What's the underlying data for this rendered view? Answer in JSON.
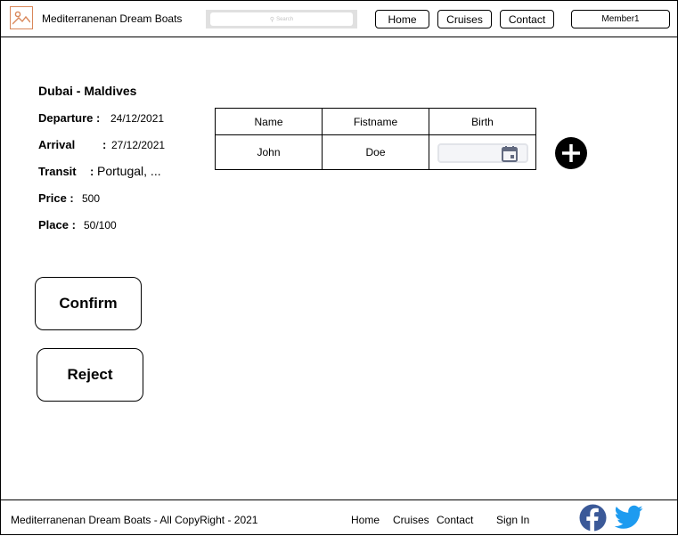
{
  "header": {
    "brand": "Mediterranenan Dream Boats",
    "search_placeholder": "Search",
    "nav": {
      "home": "Home",
      "cruises": "Cruises",
      "contact": "Contact"
    },
    "member": "Member1"
  },
  "trip": {
    "route": "Dubai - Maldives",
    "departure_label": "Departure :",
    "departure_value": "24/12/2021",
    "arrival_label": "Arrival",
    "arrival_colon": ":",
    "arrival_value": "27/12/2021",
    "transit_label": "Transit",
    "transit_colon": ":",
    "transit_value": "Portugal, ...",
    "price_label": "Price :",
    "price_value": "500",
    "place_label": "Place :",
    "place_value": "50/100"
  },
  "passengers": {
    "columns": [
      "Name",
      "Fistname",
      "Birth"
    ],
    "rows": [
      {
        "name": "John",
        "firstname": "Doe",
        "birth": ""
      }
    ]
  },
  "actions": {
    "confirm": "Confirm",
    "reject": "Reject"
  },
  "footer": {
    "copyright": "Mediterranenan Dream Boats  -  All CopyRight  -  2021",
    "home": "Home",
    "cruises": "Cruises",
    "contact": "Contact",
    "signin": "Sign In"
  },
  "colors": {
    "logo_accent": "#d9875a",
    "facebook": "#3b5998",
    "twitter": "#1d9bf0"
  }
}
